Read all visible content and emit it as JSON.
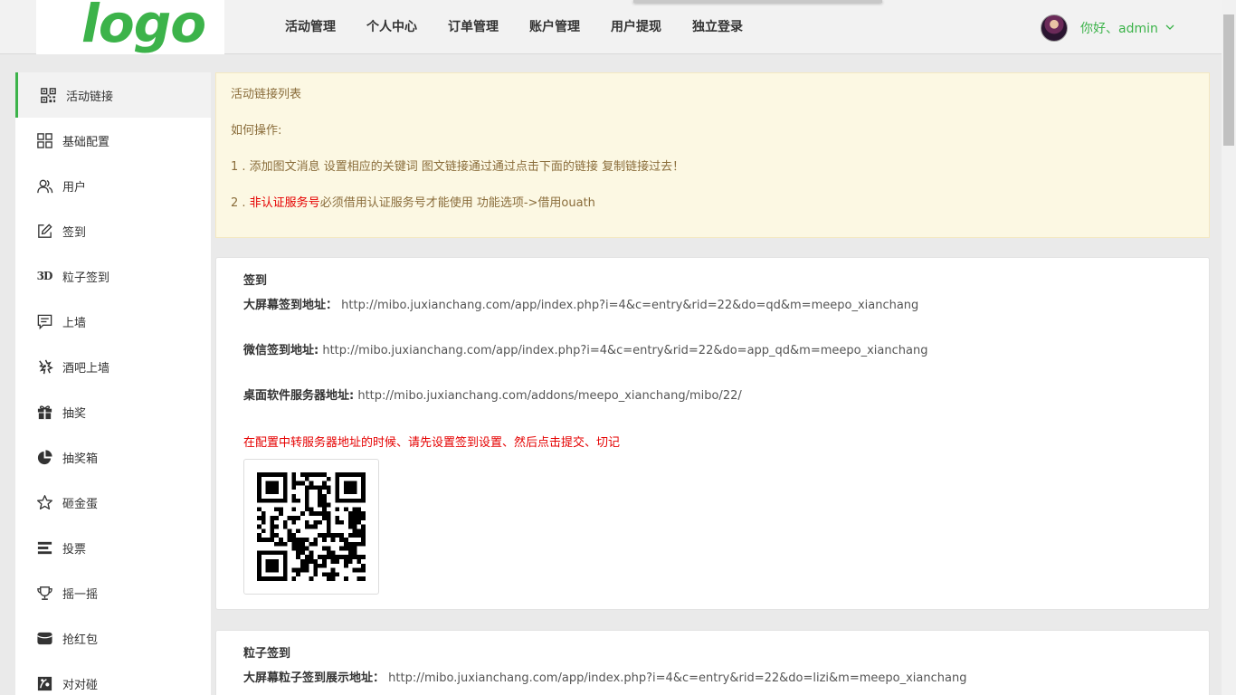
{
  "header": {
    "logo": "logo",
    "nav": [
      "活动管理",
      "个人中心",
      "订单管理",
      "账户管理",
      "用户提现",
      "独立登录"
    ],
    "user_greeting": "你好、admin",
    "caret": "⌄"
  },
  "sidebar": {
    "items": [
      {
        "label": "活动链接",
        "icon": "qr-icon"
      },
      {
        "label": "基础配置",
        "icon": "grid-icon"
      },
      {
        "label": "用户",
        "icon": "users-icon"
      },
      {
        "label": "签到",
        "icon": "edit-icon"
      },
      {
        "label": "粒子签到",
        "icon": "3d-icon",
        "glyph": "3D"
      },
      {
        "label": "上墙",
        "icon": "message-icon"
      },
      {
        "label": "酒吧上墙",
        "icon": "bar-icon"
      },
      {
        "label": "抽奖",
        "icon": "gift-icon"
      },
      {
        "label": "抽奖箱",
        "icon": "pie-icon"
      },
      {
        "label": "砸金蛋",
        "icon": "star-icon"
      },
      {
        "label": "投票",
        "icon": "vote-icon"
      },
      {
        "label": "摇一摇",
        "icon": "trophy-icon"
      },
      {
        "label": "抢红包",
        "icon": "redpacket-icon"
      },
      {
        "label": "对对碰",
        "icon": "match-icon"
      }
    ]
  },
  "notice": {
    "title": "活动链接列表",
    "howto": "如何操作:",
    "step1": "1 . 添加图文消息 设置相应的关键词 图文链接通过通过点击下面的链接 复制链接过去！",
    "step2_prefix": "2 . ",
    "step2_red": "非认证服务号",
    "step2_rest": "必须借用认证服务号才能使用 功能选项->借用ouath"
  },
  "signin_panel": {
    "title": "签到",
    "bigscreen_label": "大屏幕签到地址：",
    "bigscreen_url": "http://mibo.juxianchang.com/app/index.php?i=4&c=entry&rid=22&do=qd&m=meepo_xianchang",
    "wechat_label": "微信签到地址:",
    "wechat_url": "http://mibo.juxianchang.com/app/index.php?i=4&c=entry&rid=22&do=app_qd&m=meepo_xianchang",
    "desktop_label": "桌面软件服务器地址:",
    "desktop_url": "http://mibo.juxianchang.com/addons/meepo_xianchang/mibo/22/",
    "warning": "在配置中转服务器地址的时候、请先设置签到设置、然后点击提交、切记"
  },
  "particle_panel": {
    "title": "粒子签到",
    "bigscreen_label": "大屏幕粒子签到展示地址：",
    "bigscreen_url": "http://mibo.juxianchang.com/app/index.php?i=4&c=entry&rid=22&do=lizi&m=meepo_xianchang"
  },
  "colors": {
    "accent": "#3cb34a",
    "warning": "#e50000",
    "notice_bg": "#fcf8e3"
  }
}
